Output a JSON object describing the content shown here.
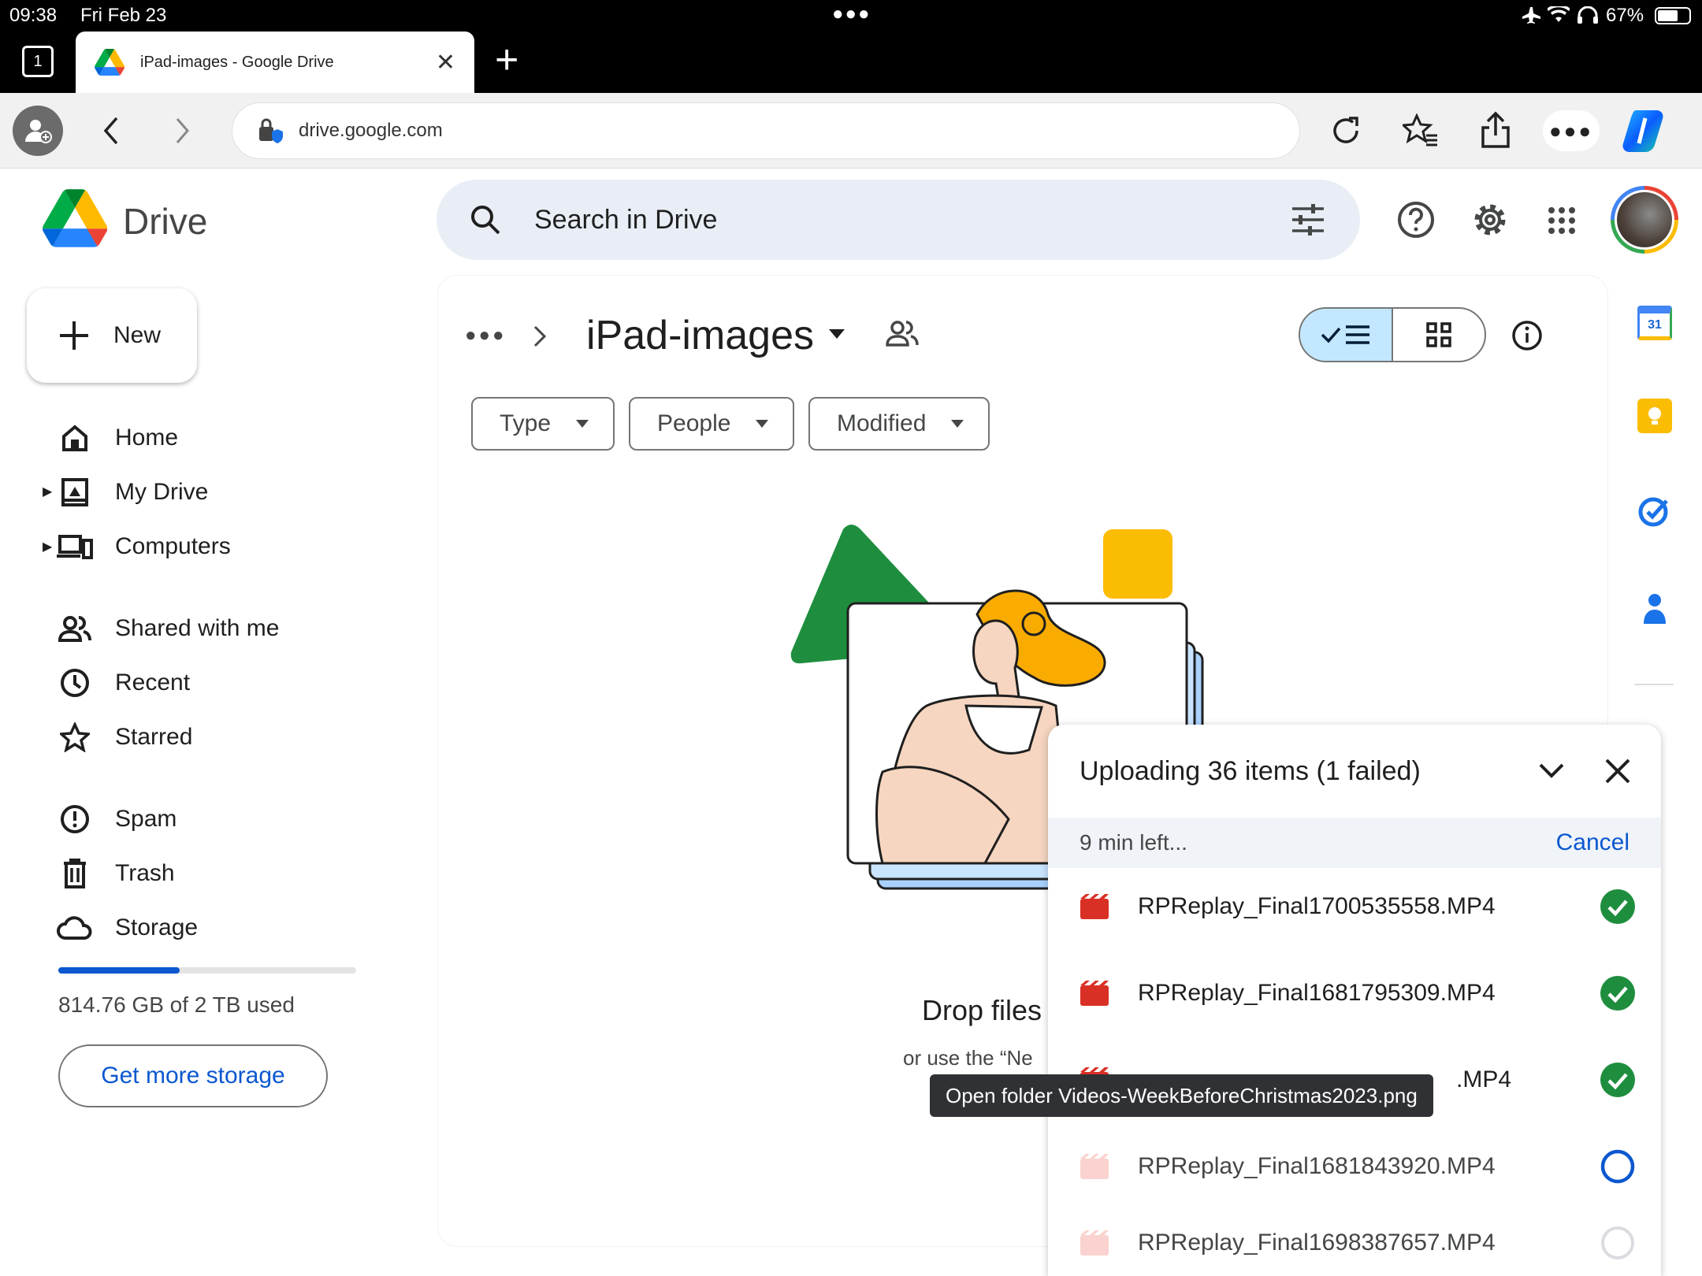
{
  "status": {
    "time": "09:38",
    "date": "Fri Feb 23",
    "battery": "67%"
  },
  "browser": {
    "tab_count": "1",
    "tab_title": "iPad-images - Google Drive",
    "url": "drive.google.com"
  },
  "drive": {
    "app_name": "Drive",
    "search_placeholder": "Search in Drive",
    "new_label": "New",
    "nav": [
      {
        "label": "Home",
        "icon": "home-icon"
      },
      {
        "label": "My Drive",
        "icon": "my-drive-icon"
      },
      {
        "label": "Computers",
        "icon": "computers-icon"
      },
      {
        "label": "Shared with me",
        "icon": "people-icon"
      },
      {
        "label": "Recent",
        "icon": "clock-icon"
      },
      {
        "label": "Starred",
        "icon": "star-icon"
      },
      {
        "label": "Spam",
        "icon": "spam-icon"
      },
      {
        "label": "Trash",
        "icon": "trash-icon"
      },
      {
        "label": "Storage",
        "icon": "cloud-icon"
      }
    ],
    "storage": {
      "used_text": "814.76 GB of 2 TB used",
      "used_fraction": 0.407,
      "button": "Get more storage"
    },
    "folder_title": "iPad-images",
    "filters": [
      "Type",
      "People",
      "Modified"
    ],
    "empty": {
      "title": "Drop files",
      "subtitle": "or use the “Ne"
    }
  },
  "upload": {
    "title": "Uploading 36 items (1 failed)",
    "time_left": "9 min left...",
    "cancel": "Cancel",
    "items": [
      {
        "name": "RPReplay_Final1700535558.MP4",
        "status": "done"
      },
      {
        "name": "RPReplay_Final1681795309.MP4",
        "status": "done"
      },
      {
        "name": ".MP4",
        "status": "done"
      },
      {
        "name": "RPReplay_Final1681843920.MP4",
        "status": "in-progress"
      },
      {
        "name": "RPReplay_Final1698387657.MP4",
        "status": "pending"
      }
    ],
    "tooltip": "Open folder Videos-WeekBeforeChristmas2023.png"
  },
  "colors": {
    "accent": "#0b57d0",
    "success": "#1e8e3e",
    "video": "#d93025",
    "highlight": "#c2e7ff"
  }
}
